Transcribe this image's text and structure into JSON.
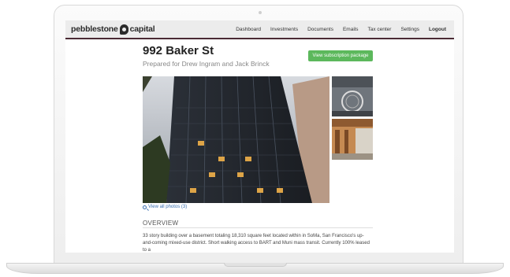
{
  "brand": {
    "word1": "pebblestone",
    "word2": "capital"
  },
  "nav": {
    "items": [
      "Dashboard",
      "Investments",
      "Documents",
      "Emails",
      "Tax center",
      "Settings"
    ],
    "logout": "Logout"
  },
  "property": {
    "title": "992 Baker St",
    "subtitle": "Prepared for Drew Ingram and Jack Brinck",
    "button": "View subscription package",
    "view_photos": "View all photos (3)"
  },
  "overview": {
    "heading": "OVERVIEW",
    "text": "33 story building over a basement totaling 18,310 square feet located within in SoMa, San Francisco's up-and-coming mixed-use district. Short walking access to BART and Muni mass transit. Currently 100% leased to a"
  },
  "colors": {
    "accent_green": "#5cb85c",
    "nav_border": "#4a2a34",
    "link_blue": "#3a6fb0"
  },
  "icons": [
    "logo-mark-icon",
    "magnifier-icon",
    "camera-icon"
  ]
}
